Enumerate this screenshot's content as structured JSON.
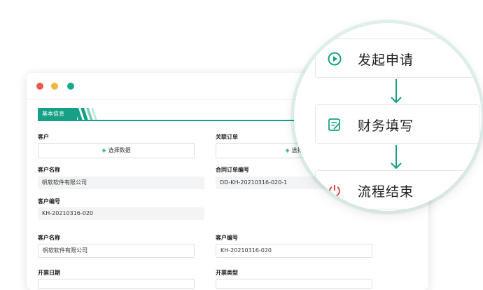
{
  "window": {
    "section_title": "基本信息"
  },
  "form": {
    "customer_label": "客户",
    "customer_select": "选择数据",
    "related_order_label": "关联订单",
    "related_order_select": "选择",
    "customer_name_label": "客户名称",
    "customer_name_value": "帆软软件有限公司",
    "contract_no_label": "合同订单编号",
    "contract_no_value": "DD-KH-20210316-020-1",
    "customer_code_label": "客户编号",
    "customer_code_value": "KH-20210316-020",
    "customer_name2_label": "客户名称",
    "customer_name2_value": "帆软软件有限公司",
    "customer_code2_label": "客户编号",
    "customer_code2_value": "KH-20210316-020",
    "invoice_date_label": "开票日期",
    "invoice_type_label": "开票类型"
  },
  "workflow": {
    "steps": [
      {
        "label": "发起申请",
        "icon": "play-circle-icon"
      },
      {
        "label": "财务填写",
        "icon": "edit-note-icon"
      },
      {
        "label": "流程结束",
        "icon": "power-icon"
      }
    ]
  },
  "colors": {
    "accent": "#16a085",
    "dot_red": "#e9584f",
    "dot_yellow": "#f3b63d",
    "dot_green": "#1aaa8f",
    "power_red": "#e04848"
  }
}
